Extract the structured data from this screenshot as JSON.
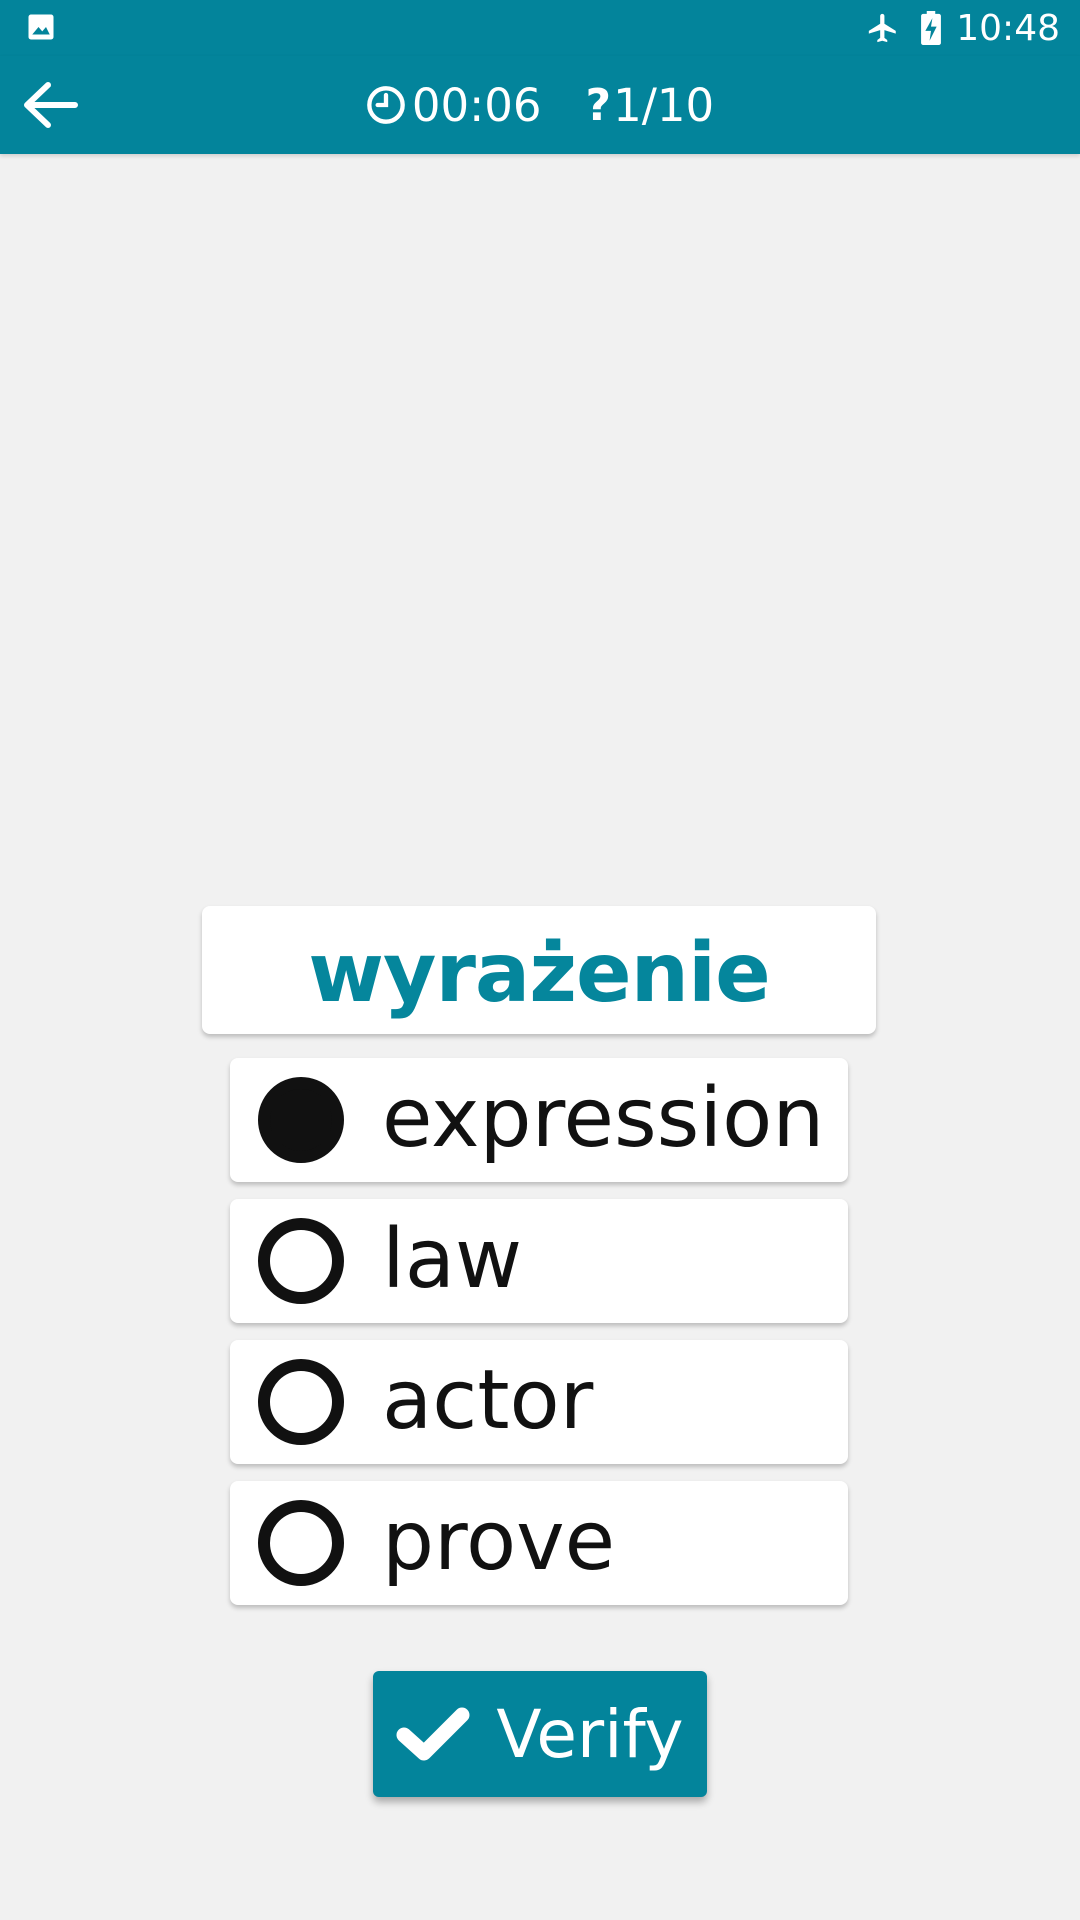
{
  "status_bar": {
    "time": "10:48",
    "icons": [
      "gallery-icon",
      "airplane-icon",
      "battery-charging-icon"
    ]
  },
  "app_bar": {
    "back_icon": "arrow-left-icon",
    "timer_icon": "clock-icon",
    "timer": "00:06",
    "progress_icon": "question-icon",
    "progress_symbol": "?",
    "progress": "1/10"
  },
  "quiz": {
    "word": "wyrażenie",
    "options": [
      {
        "label": "expression",
        "selected": true
      },
      {
        "label": "law",
        "selected": false
      },
      {
        "label": "actor",
        "selected": false
      },
      {
        "label": "prove",
        "selected": false
      }
    ]
  },
  "verify_button": {
    "icon": "check-icon",
    "label": "Verify"
  },
  "colors": {
    "primary": "#03849b",
    "word": "#05869c",
    "background": "#f1f1f1",
    "card": "#ffffff",
    "text": "#111111"
  }
}
